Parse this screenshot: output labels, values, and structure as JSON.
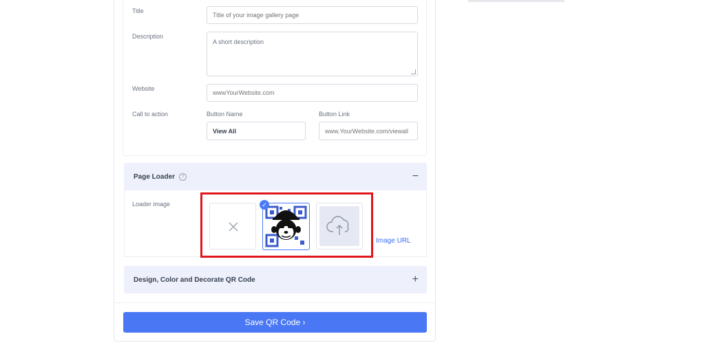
{
  "form": {
    "title_label": "Title",
    "title_placeholder": "Title of your image gallery page",
    "description_label": "Description",
    "description_placeholder": "A short description",
    "website_label": "Website",
    "website_placeholder": "wwwYourWebsite.com",
    "cta_label": "Call to action",
    "button_name_label": "Button Name",
    "button_name_value": "View All",
    "button_link_label": "Button Link",
    "button_link_placeholder": "www.YourWebsite.com/viewall"
  },
  "page_loader": {
    "title": "Page Loader",
    "help_glyph": "?",
    "collapse_glyph": "−",
    "loader_image_label": "Loader image",
    "image_url_link": "Image URL",
    "tiles": [
      "none",
      "selected-qr-logo",
      "upload"
    ]
  },
  "design": {
    "title": "Design, Color and Decorate QR Code",
    "expand_glyph": "+"
  },
  "save_button": "Save QR Code ›",
  "colors": {
    "accent": "#4a78f5",
    "highlight": "#e0161c",
    "section_bg": "#eef0fb"
  }
}
